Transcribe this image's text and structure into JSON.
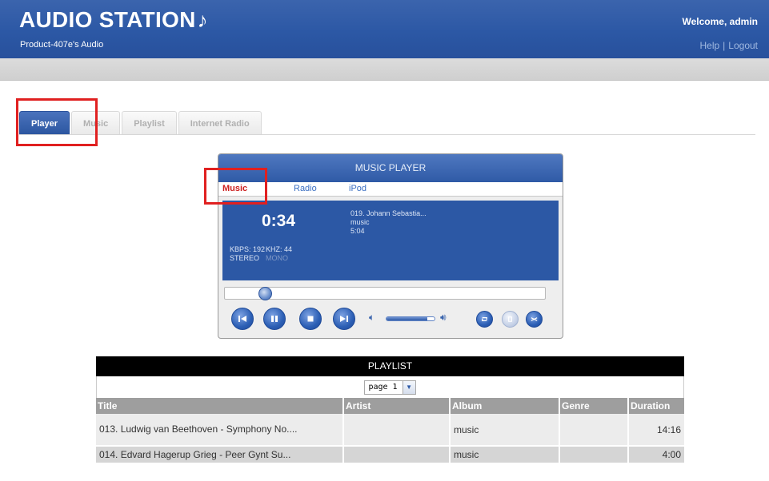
{
  "header": {
    "brand": "AUDIO STATION",
    "brand_icon": "music-note-icon",
    "subtitle": "Product-407e's Audio",
    "welcome": "Welcome, admin",
    "help": "Help",
    "separator": "|",
    "logout": "Logout",
    "colors": {
      "header_blue": "#2c58a5",
      "highlight_red": "#e02020"
    }
  },
  "tabs": [
    {
      "label": "Player",
      "active": true
    },
    {
      "label": "Music",
      "active": false
    },
    {
      "label": "Playlist",
      "active": false
    },
    {
      "label": "Internet Radio",
      "active": false
    }
  ],
  "player": {
    "title": "MUSIC PLAYER",
    "sources": [
      {
        "label": "Music",
        "active": true
      },
      {
        "label": "Radio",
        "active": false
      },
      {
        "label": "iPod",
        "active": false
      }
    ],
    "elapsed": "0:34",
    "track_title": "019. Johann Sebastia...",
    "track_album": "music",
    "track_length": "5:04",
    "kbps": "KBPS: 192",
    "khz": "KHZ: 44",
    "stereo": "STEREO",
    "mono": "MONO",
    "progress_fraction": 0.11,
    "volume_fraction": 0.85,
    "controls": [
      "previous-icon",
      "pause-icon",
      "stop-icon",
      "next-icon",
      "volume-down-icon",
      "volume-up-icon",
      "repeat-icon",
      "repeat-one-icon",
      "shuffle-icon"
    ]
  },
  "playlist": {
    "title": "PLAYLIST",
    "page": "page 1",
    "columns": [
      "Title",
      "Artist",
      "Album",
      "Genre",
      "Duration"
    ],
    "rows": [
      {
        "title": "013. Ludwig van Beethoven - Symphony No....",
        "artist": "",
        "album": "music",
        "genre": "",
        "duration": "14:16"
      },
      {
        "title": "014. Edvard Hagerup Grieg - Peer Gynt Su...",
        "artist": "",
        "album": "music",
        "genre": "",
        "duration": "4:00"
      }
    ]
  }
}
